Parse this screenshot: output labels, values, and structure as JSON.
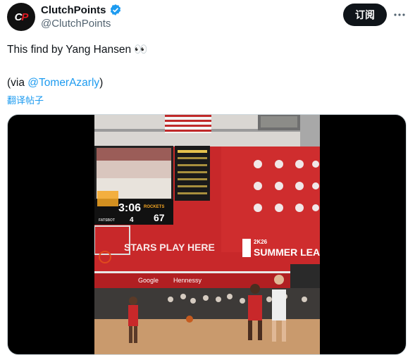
{
  "author": {
    "display_name": "ClutchPoints",
    "handle": "@ClutchPoints",
    "avatar_text_a": "C",
    "avatar_text_b": "P"
  },
  "actions": {
    "subscribe_label": "订阅"
  },
  "tweet": {
    "text": "This find by Yang Hansen 👀",
    "via_prefix": "(via ",
    "via_mention": "@TomerAzarly",
    "via_suffix": ")",
    "translate_label": "翻译帖子"
  },
  "video": {
    "score_time": "3:06",
    "score_team": "ROCKETS",
    "score_home": "67",
    "period": "4",
    "sponsor_left": "FATSBOT",
    "banner_text": "STARS PLAY HERE",
    "league_top": "2K26",
    "league_name": "SUMMER LEAGUE",
    "ad_1": "Google",
    "ad_2": "Hennessy"
  },
  "colors": {
    "accent": "#1d9bf0",
    "verified": "#1d9bf0",
    "arena_red": "#c8282a",
    "button_bg": "#0f1419"
  }
}
